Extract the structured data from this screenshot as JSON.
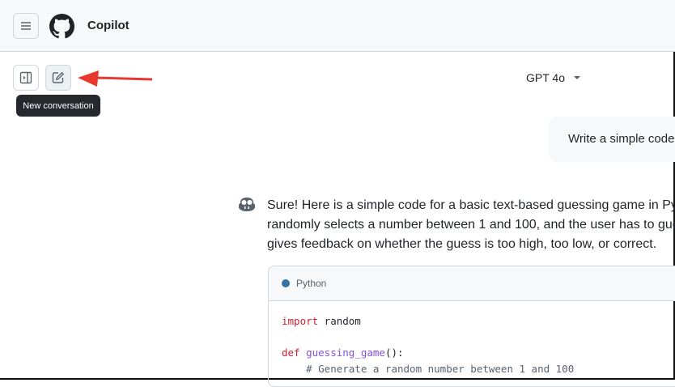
{
  "header": {
    "title": "Copilot",
    "menu_icon": "hamburger-icon",
    "logo": "github-logo"
  },
  "toolbar": {
    "tooltip": "New conversation",
    "sidebar_icon": "sidebar-toggle-icon",
    "new_icon": "edit-icon"
  },
  "model": {
    "selected": "GPT 4o"
  },
  "user_message": "Write a simple code",
  "assistant": {
    "lines": [
      "Sure! Here is a simple code for a basic text-based guessing game in Python",
      "randomly selects a number between 1 and 100, and the user has to guess",
      "gives feedback on whether the guess is too high, too low, or correct."
    ]
  },
  "code": {
    "language": "Python",
    "language_color": "#3572A5",
    "l1_kw": "import",
    "l1_rest": " random",
    "l3_kw": "def",
    "l3_fn": "guessing_game",
    "l3_rest": "():",
    "l4_comment": "    # Generate a random number between 1 and 100"
  }
}
